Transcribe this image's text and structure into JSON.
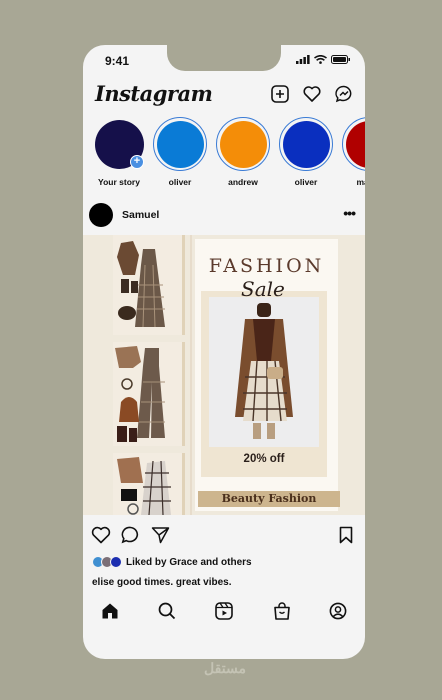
{
  "status": {
    "time": "9:41"
  },
  "header": {
    "logo": "Instagram"
  },
  "stories": [
    {
      "label": "Your story",
      "color": "#15104a",
      "own": true
    },
    {
      "label": "oliver",
      "color": "#0a7bd6"
    },
    {
      "label": "andrew",
      "color": "#f48d08"
    },
    {
      "label": "oliver",
      "color": "#0a2fbf"
    },
    {
      "label": "mateo",
      "color": "#b00000"
    }
  ],
  "post": {
    "username": "Samuel",
    "poster": {
      "title": "FASHION",
      "script": "Sale",
      "offer": "20% off",
      "band": "Beauty Fashion"
    },
    "liked_by": "Liked by Grace and others",
    "liked_avatar_colors": [
      "#3f8fd1",
      "#7b6f77",
      "#1c2eb0"
    ],
    "caption": "elise good times. great vibes."
  },
  "tabbar": {
    "icons": [
      "home-icon",
      "search-icon",
      "reels-icon",
      "shop-icon",
      "profile-icon"
    ]
  },
  "watermark": "مستقل"
}
